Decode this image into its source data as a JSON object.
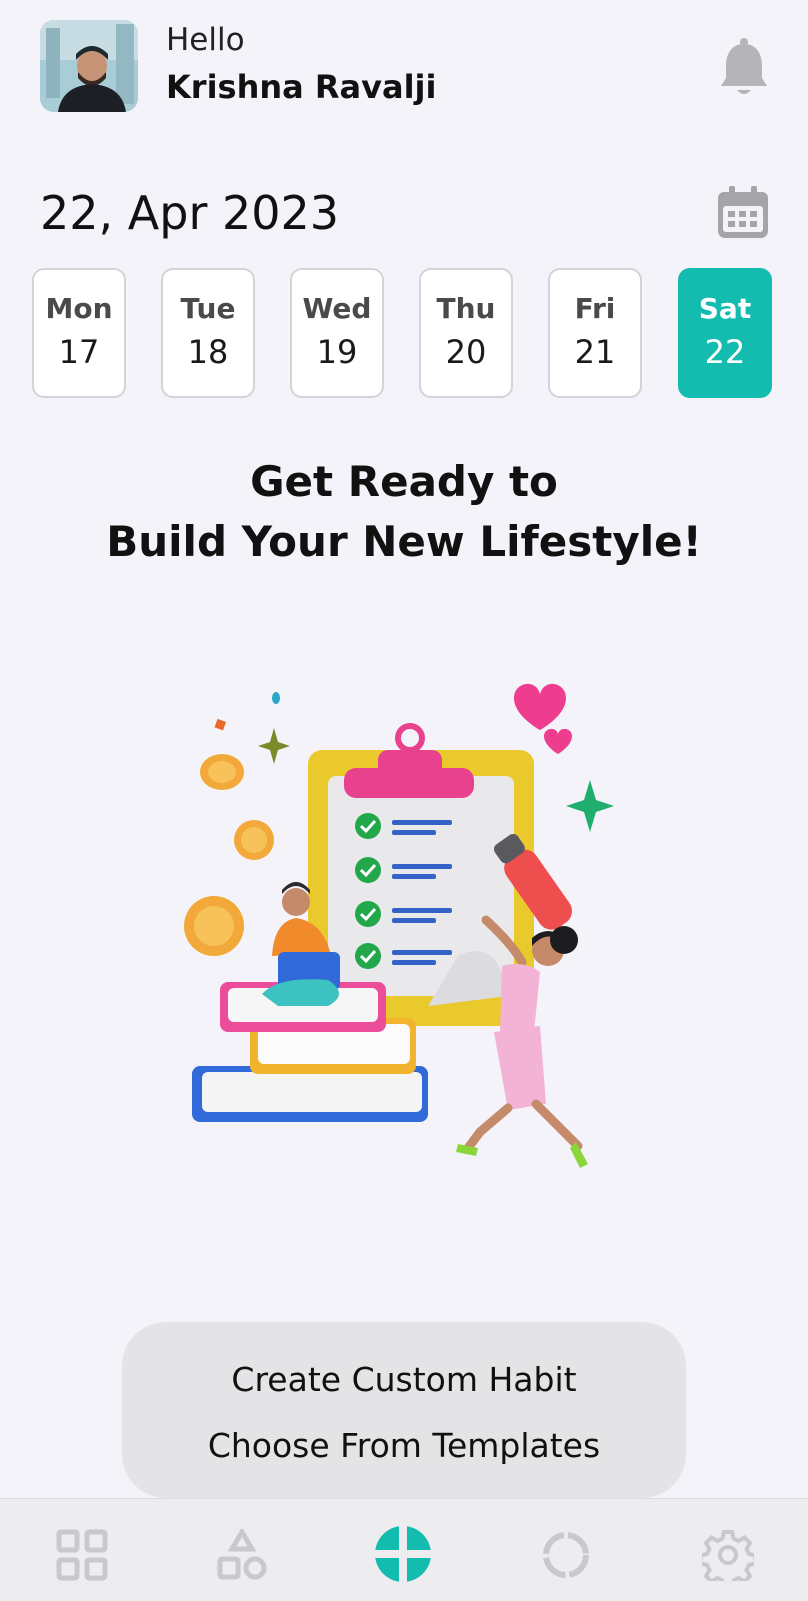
{
  "header": {
    "greeting": "Hello",
    "user_name": "Krishna Ravalji",
    "notification_icon": "bell-icon"
  },
  "date_bar": {
    "current_date": "22, Apr 2023",
    "calendar_icon": "calendar-icon",
    "days": [
      {
        "name": "Mon",
        "date": "17",
        "selected": false
      },
      {
        "name": "Tue",
        "date": "18",
        "selected": false
      },
      {
        "name": "Wed",
        "date": "19",
        "selected": false
      },
      {
        "name": "Thu",
        "date": "20",
        "selected": false
      },
      {
        "name": "Fri",
        "date": "21",
        "selected": false
      },
      {
        "name": "Sat",
        "date": "22",
        "selected": true
      }
    ]
  },
  "main": {
    "headline_line1": "Get Ready to",
    "headline_line2": "Build Your New Lifestyle!"
  },
  "add_menu": {
    "create_custom": "Create Custom Habit",
    "choose_templates": "Choose From Templates"
  },
  "tabbar": {
    "tabs": [
      {
        "icon": "grid-icon"
      },
      {
        "icon": "shapes-icon"
      },
      {
        "icon": "add-close-icon",
        "active": true
      },
      {
        "icon": "progress-ring-icon"
      },
      {
        "icon": "gear-icon"
      }
    ]
  },
  "colors": {
    "accent": "#14bcb0",
    "background": "#f3f3f9",
    "tab_icon_inactive": "#c9c9cd"
  }
}
